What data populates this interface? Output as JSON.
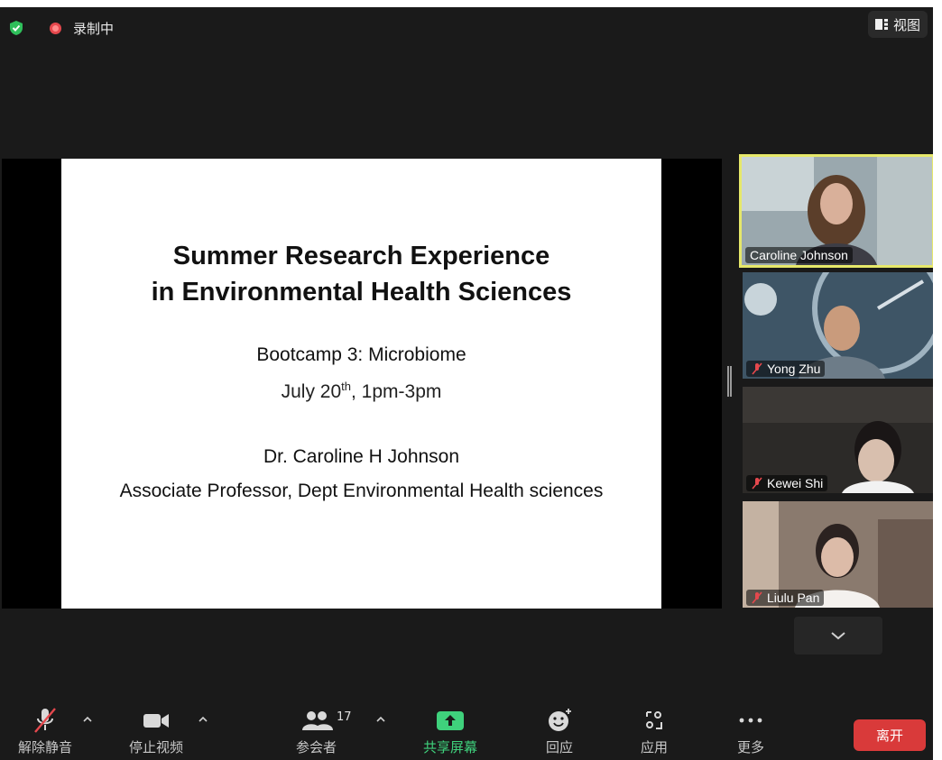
{
  "topbar": {
    "recording_label": "录制中",
    "view_label": "视图"
  },
  "slide": {
    "title_line1": "Summer Research Experience",
    "title_line2": "in Environmental Health Sciences",
    "subtitle": "Bootcamp 3: Microbiome",
    "date_prefix": "July 20",
    "date_sup": "th",
    "date_suffix": ", 1pm-3pm",
    "presenter": "Dr. Caroline H Johnson",
    "role": "Associate Professor, Dept Environmental Health sciences"
  },
  "participants": [
    {
      "name": "Caroline Johnson",
      "muted": false,
      "active_speaker": true
    },
    {
      "name": "Yong Zhu",
      "muted": true
    },
    {
      "name": "Kewei Shi",
      "muted": true
    },
    {
      "name": "Liulu Pan",
      "muted": true
    }
  ],
  "toolbar": {
    "unmute_label": "解除静音",
    "stop_video_label": "停止视频",
    "participants_label": "参会者",
    "participants_count": "17",
    "share_label": "共享屏幕",
    "reactions_label": "回应",
    "apps_label": "应用",
    "more_label": "更多",
    "leave_label": "离开"
  },
  "colors": {
    "background": "#1a1a1a",
    "active_speaker_border": "#e6e86a",
    "share_green": "#3fd17c",
    "leave_red": "#d93a3a",
    "mute_red": "#e5484d"
  },
  "icons": [
    "shield-check-icon",
    "recording-icon",
    "view-grid-icon",
    "microphone-muted-icon",
    "video-camera-icon",
    "participants-icon",
    "share-arrow-icon",
    "reaction-emoji-icon",
    "apps-icon",
    "more-dots-icon",
    "chevron-down-icon",
    "chevron-up-icon"
  ]
}
